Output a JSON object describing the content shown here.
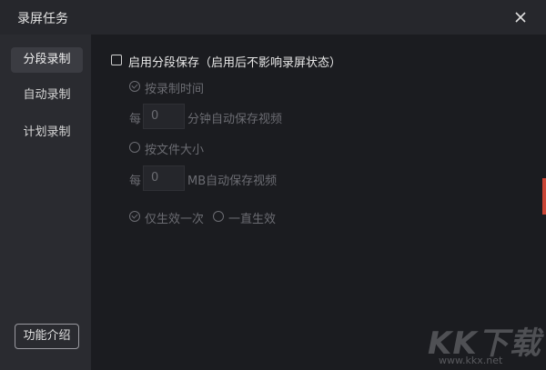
{
  "window": {
    "title": "录屏任务"
  },
  "sidebar": {
    "items": [
      {
        "label": "分段录制",
        "active": true
      },
      {
        "label": "自动录制",
        "active": false
      },
      {
        "label": "计划录制",
        "active": false
      }
    ],
    "intro_button": "功能介绍"
  },
  "segment": {
    "enable_label": "启用分段保存（启用后不影响录屏状态）",
    "enable_checked": false,
    "by_time": {
      "label": "按录制时间",
      "checked": true,
      "prefix": "每",
      "value": "0",
      "suffix": "分钟自动保存视频"
    },
    "by_size": {
      "label": "按文件大小",
      "checked": false,
      "prefix": "每",
      "value": "0",
      "suffix": "MB自动保存视频"
    },
    "once_label": "仅生效一次",
    "once_checked": true,
    "always_label": "一直生效",
    "always_checked": false
  },
  "watermark": {
    "text": "KK下载",
    "url": "www.kkx.net"
  },
  "colors": {
    "accent": "#c94535",
    "background": "#1b1c20",
    "sidebar": "#2a2b30"
  }
}
